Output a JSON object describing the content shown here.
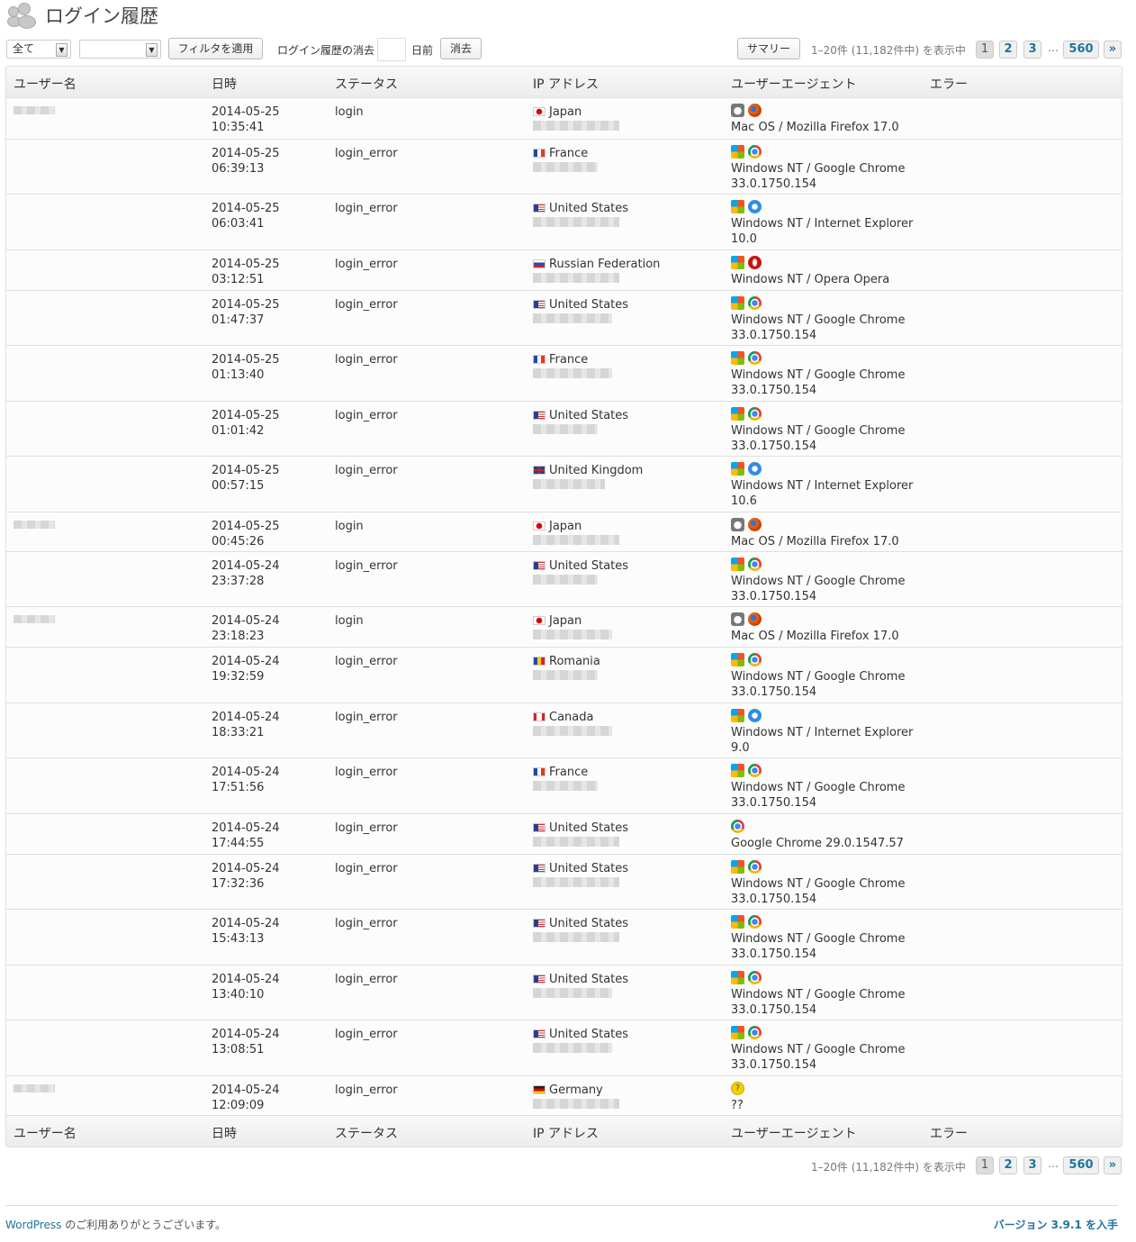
{
  "page": {
    "title": "ログイン履歴"
  },
  "toolbar": {
    "filter_select": "全て",
    "filter_select2": "",
    "apply_filter": "フィルタを適用",
    "purge_label": "ログイン履歴の消去",
    "days_label": "日前",
    "purge_button": "消去",
    "summary_button": "サマリー"
  },
  "pagination": {
    "info": "1–20件 (11,182件中) を表示中",
    "pages": [
      "1",
      "2",
      "3"
    ],
    "ellipsis": "…",
    "last": "560",
    "next": "»"
  },
  "columns": [
    "ユーザー名",
    "日時",
    "ステータス",
    "IP アドレス",
    "ユーザーエージェント",
    "エラー"
  ],
  "rows": [
    {
      "user": true,
      "date": "2014-05-25",
      "time": "10:35:41",
      "status": "login",
      "country": "Japan",
      "flag": "jp",
      "os": "mac",
      "browser": "firefox",
      "ua1": "Mac OS / Mozilla Firefox 17.0",
      "ua2": ""
    },
    {
      "user": false,
      "date": "2014-05-25",
      "time": "06:39:13",
      "status": "login_error",
      "country": "France",
      "flag": "fr",
      "os": "win",
      "browser": "chrome",
      "ua1": "Windows NT / Google Chrome",
      "ua2": "33.0.1750.154"
    },
    {
      "user": false,
      "date": "2014-05-25",
      "time": "06:03:41",
      "status": "login_error",
      "country": "United States",
      "flag": "us",
      "os": "win",
      "browser": "ie",
      "ua1": "Windows NT / Internet Explorer",
      "ua2": "10.0"
    },
    {
      "user": false,
      "date": "2014-05-25",
      "time": "03:12:51",
      "status": "login_error",
      "country": "Russian Federation",
      "flag": "ru",
      "os": "win",
      "browser": "opera",
      "ua1": "Windows NT / Opera Opera",
      "ua2": ""
    },
    {
      "user": false,
      "date": "2014-05-25",
      "time": "01:47:37",
      "status": "login_error",
      "country": "United States",
      "flag": "us",
      "os": "win",
      "browser": "chrome",
      "ua1": "Windows NT / Google Chrome",
      "ua2": "33.0.1750.154"
    },
    {
      "user": false,
      "date": "2014-05-25",
      "time": "01:13:40",
      "status": "login_error",
      "country": "France",
      "flag": "fr",
      "os": "win",
      "browser": "chrome",
      "ua1": "Windows NT / Google Chrome",
      "ua2": "33.0.1750.154"
    },
    {
      "user": false,
      "date": "2014-05-25",
      "time": "01:01:42",
      "status": "login_error",
      "country": "United States",
      "flag": "us",
      "os": "win",
      "browser": "chrome",
      "ua1": "Windows NT / Google Chrome",
      "ua2": "33.0.1750.154"
    },
    {
      "user": false,
      "date": "2014-05-25",
      "time": "00:57:15",
      "status": "login_error",
      "country": "United Kingdom",
      "flag": "gb",
      "os": "win",
      "browser": "ie",
      "ua1": "Windows NT / Internet Explorer",
      "ua2": "10.6"
    },
    {
      "user": true,
      "date": "2014-05-25",
      "time": "00:45:26",
      "status": "login",
      "country": "Japan",
      "flag": "jp",
      "os": "mac",
      "browser": "firefox",
      "ua1": "Mac OS / Mozilla Firefox 17.0",
      "ua2": ""
    },
    {
      "user": false,
      "date": "2014-05-24",
      "time": "23:37:28",
      "status": "login_error",
      "country": "United States",
      "flag": "us",
      "os": "win",
      "browser": "chrome",
      "ua1": "Windows NT / Google Chrome",
      "ua2": "33.0.1750.154"
    },
    {
      "user": true,
      "date": "2014-05-24",
      "time": "23:18:23",
      "status": "login",
      "country": "Japan",
      "flag": "jp",
      "os": "mac",
      "browser": "firefox",
      "ua1": "Mac OS / Mozilla Firefox 17.0",
      "ua2": ""
    },
    {
      "user": false,
      "date": "2014-05-24",
      "time": "19:32:59",
      "status": "login_error",
      "country": "Romania",
      "flag": "ro",
      "os": "win",
      "browser": "chrome",
      "ua1": "Windows NT / Google Chrome",
      "ua2": "33.0.1750.154"
    },
    {
      "user": false,
      "date": "2014-05-24",
      "time": "18:33:21",
      "status": "login_error",
      "country": "Canada",
      "flag": "ca",
      "os": "win",
      "browser": "ie",
      "ua1": "Windows NT / Internet Explorer",
      "ua2": "9.0"
    },
    {
      "user": false,
      "date": "2014-05-24",
      "time": "17:51:56",
      "status": "login_error",
      "country": "France",
      "flag": "fr",
      "os": "win",
      "browser": "chrome",
      "ua1": "Windows NT / Google Chrome",
      "ua2": "33.0.1750.154"
    },
    {
      "user": false,
      "date": "2014-05-24",
      "time": "17:44:55",
      "status": "login_error",
      "country": "United States",
      "flag": "us",
      "os": "",
      "browser": "chrome",
      "ua1": "Google Chrome 29.0.1547.57",
      "ua2": ""
    },
    {
      "user": false,
      "date": "2014-05-24",
      "time": "17:32:36",
      "status": "login_error",
      "country": "United States",
      "flag": "us",
      "os": "win",
      "browser": "chrome",
      "ua1": "Windows NT / Google Chrome",
      "ua2": "33.0.1750.154"
    },
    {
      "user": false,
      "date": "2014-05-24",
      "time": "15:43:13",
      "status": "login_error",
      "country": "United States",
      "flag": "us",
      "os": "win",
      "browser": "chrome",
      "ua1": "Windows NT / Google Chrome",
      "ua2": "33.0.1750.154"
    },
    {
      "user": false,
      "date": "2014-05-24",
      "time": "13:40:10",
      "status": "login_error",
      "country": "United States",
      "flag": "us",
      "os": "win",
      "browser": "chrome",
      "ua1": "Windows NT / Google Chrome",
      "ua2": "33.0.1750.154"
    },
    {
      "user": false,
      "date": "2014-05-24",
      "time": "13:08:51",
      "status": "login_error",
      "country": "United States",
      "flag": "us",
      "os": "win",
      "browser": "chrome",
      "ua1": "Windows NT / Google Chrome",
      "ua2": "33.0.1750.154"
    },
    {
      "user": true,
      "date": "2014-05-24",
      "time": "12:09:09",
      "status": "login_error",
      "country": "Germany",
      "flag": "de",
      "os": "",
      "browser": "unknown",
      "ua1": "??",
      "ua2": ""
    }
  ],
  "footer": {
    "thanks_link": "WordPress",
    "thanks_text": " のご利用ありがとうございます。",
    "version": "バージョン 3.9.1 を入手"
  },
  "colors": {
    "link": "#21759b",
    "border": "#dfdfdf",
    "header_bg": "#ececec"
  }
}
